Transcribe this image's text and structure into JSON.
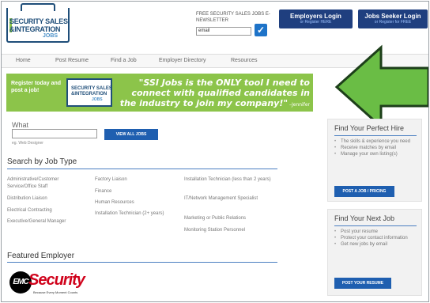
{
  "header": {
    "logo_line1": "SECURITY SALES",
    "logo_line2": "&INTEGRATION",
    "logo_line3": "JOBS",
    "newsletter_label": "FREE SECURITY SALES JOBS E-NEWSLETTER",
    "email_placeholder": "email",
    "check_glyph": "✓",
    "employers_login": "Employers Login",
    "employers_sub": "or Register HERE",
    "seeker_login": "Jobs Seeker Login",
    "seeker_sub": "or Register for FREE"
  },
  "nav": {
    "items": [
      "Home",
      "Post Resume",
      "Find a Job",
      "Employer Directory",
      "Resources"
    ]
  },
  "banner": {
    "register": "Register today and post a job!",
    "logo_a": "SECURITY SALES",
    "logo_b": "&INTEGRATION",
    "logo_c": "JOBS",
    "quote": "\"SSI Jobs is the ONLY tool I need to connect with qualified candidates in the industry to join my company!\"",
    "attribution": " –Jennifer Kough, IDMC, Inc."
  },
  "search": {
    "label": "What",
    "hint": "eg. Web Designer",
    "button": "VIEW ALL JOBS"
  },
  "job_types": {
    "title": "Search by Job Type",
    "col1": [
      "Administrative/Customer Service/Office Staff",
      "Distribution Liaison",
      "Electrical Contracting",
      "Executive/General Manager"
    ],
    "col2": [
      "Factory Liaison",
      "Finance",
      "Human Resources",
      "Installation Technician (2+ years)"
    ],
    "col3": [
      "Installation Technician (less than 2 years)",
      "IT/Network Management Specialist",
      "Marketing or Public Relations",
      "Monitoring Station Personnel"
    ]
  },
  "featured": {
    "title": "Featured Employer",
    "logo_circle": "EMC",
    "logo_word": "Security",
    "logo_tag": "Because Every Moment Counts"
  },
  "hire_box": {
    "title": "Find Your Perfect Hire",
    "items": [
      "The skills & experience you need",
      "Receive matches by email",
      "Manage your own listing(s)"
    ],
    "button": "POST A JOB / PRICING"
  },
  "job_box": {
    "title": "Find Your Next Job",
    "items": [
      "Post your resume",
      "Protect your contact information",
      "Get new jobs by email"
    ],
    "button": "POST YOUR RESUME"
  },
  "colors": {
    "navy": "#1f3f7f",
    "button_blue": "#1f5fb0",
    "banner_green": "#8cc44a",
    "arrow_green": "#6abd45"
  }
}
